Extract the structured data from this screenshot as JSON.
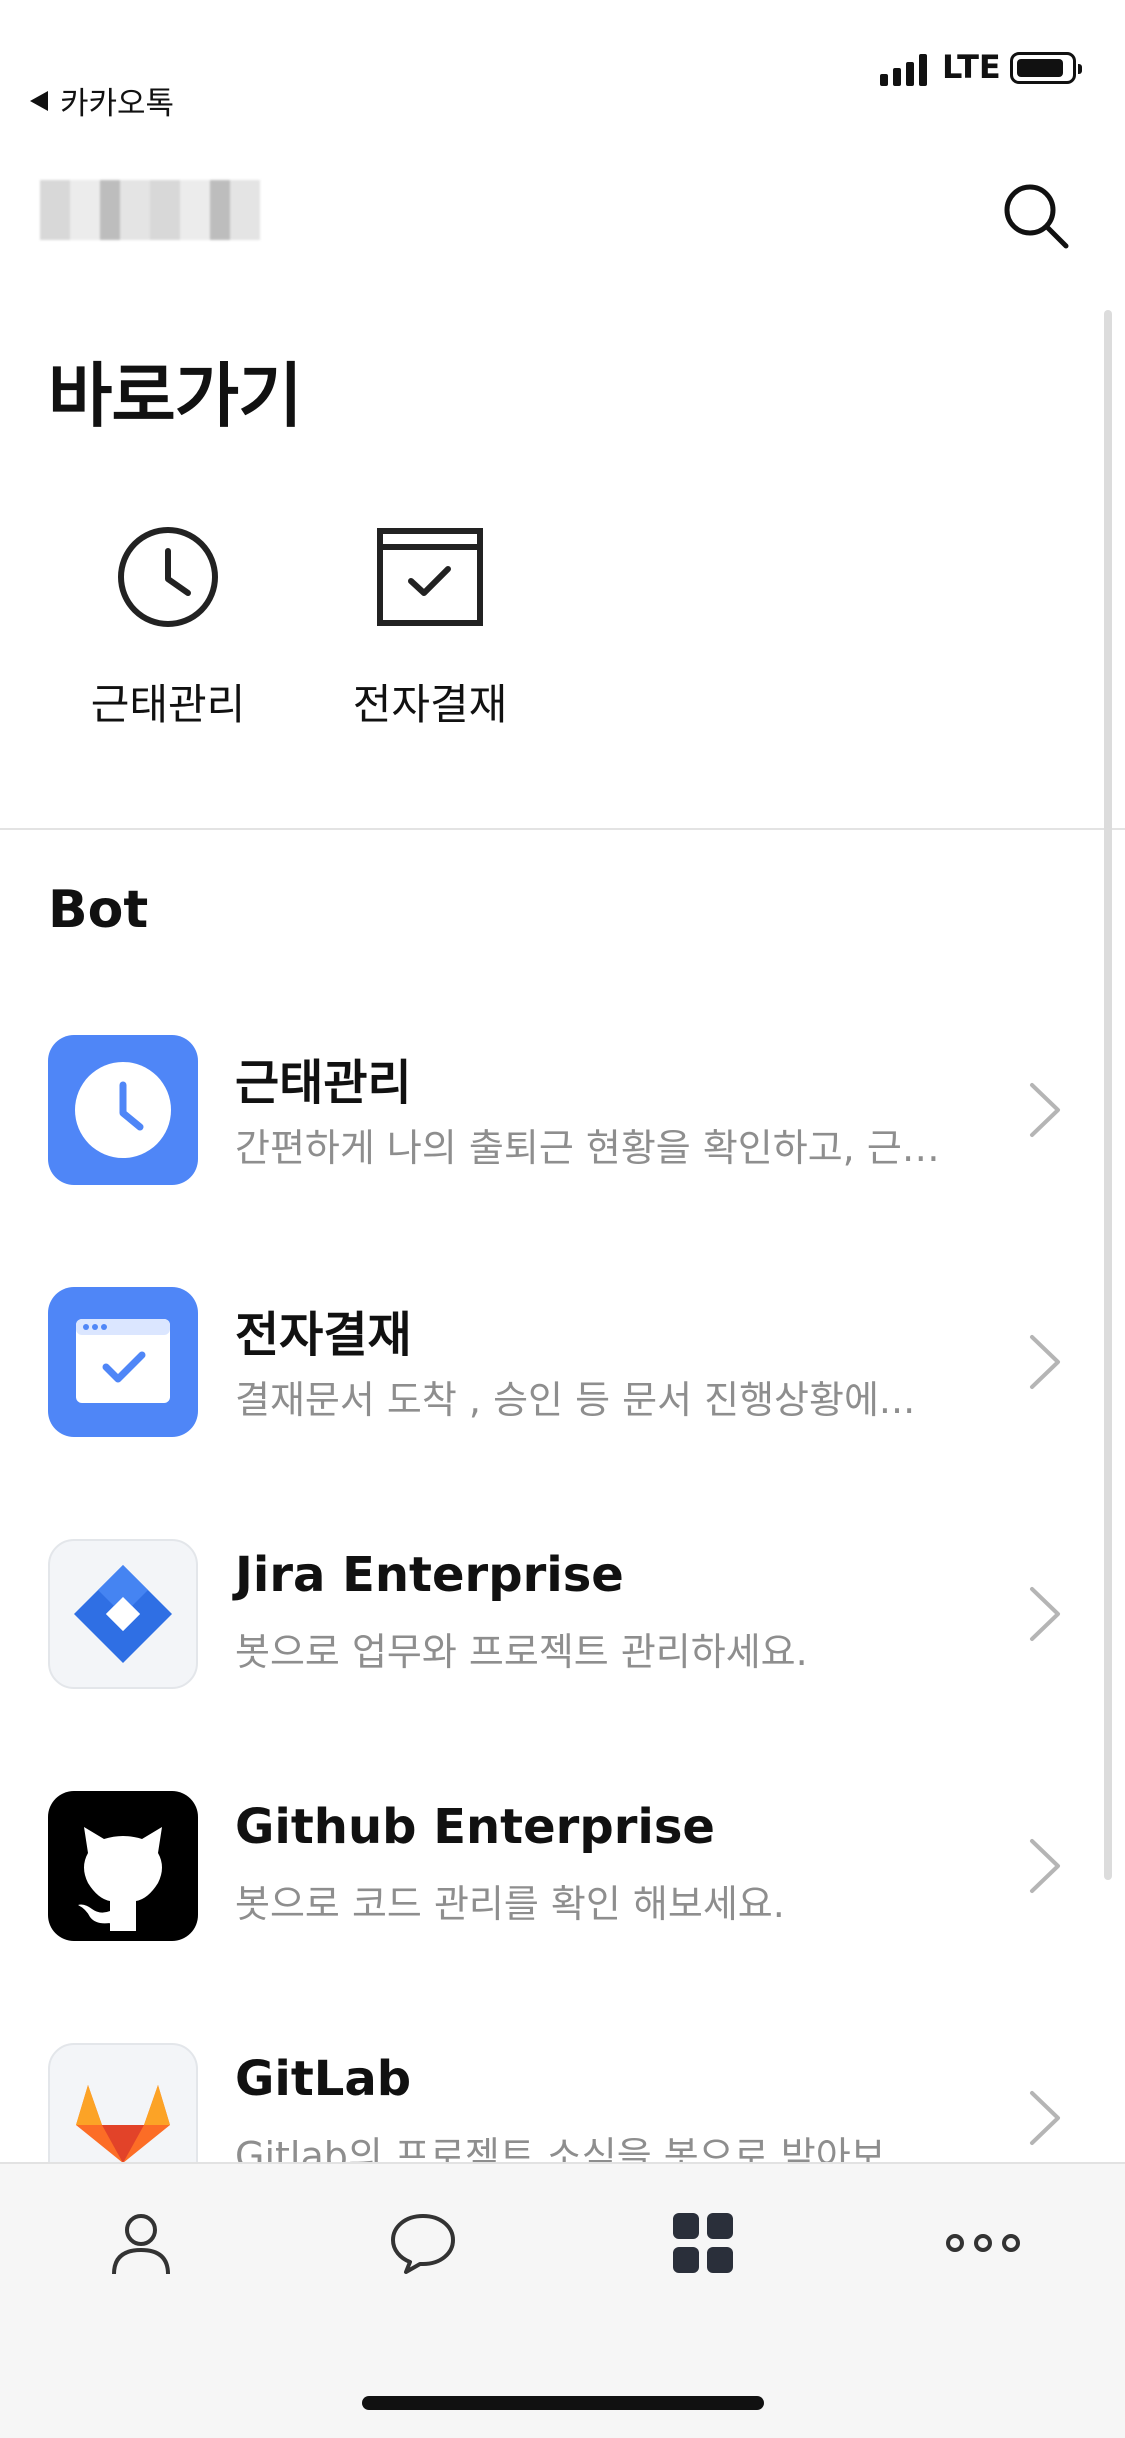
{
  "status_bar": {
    "back_label": "카카오톡",
    "network": "LTE"
  },
  "header": {
    "search_icon": "search-icon"
  },
  "shortcuts": {
    "title": "바로가기",
    "items": [
      {
        "label": "근태관리",
        "icon": "clock-icon"
      },
      {
        "label": "전자결재",
        "icon": "approval-calendar-icon"
      }
    ]
  },
  "bots": {
    "title": "Bot",
    "items": [
      {
        "name": "근태관리",
        "description": "간편하게 나의 출퇴근 현황을 확인하고, 근…",
        "icon": "clock-bot-icon",
        "icon_bg": "#4f86f7"
      },
      {
        "name": "전자결재",
        "description": "결재문서 도착 , 승인 등 문서 진행상황에...",
        "icon": "approval-bot-icon",
        "icon_bg": "#4f86f7"
      },
      {
        "name": "Jira Enterprise",
        "description": "봇으로 업무와 프로젝트 관리하세요.",
        "icon": "jira-icon",
        "icon_bg": "#f3f5f8"
      },
      {
        "name": "Github Enterprise",
        "description": "봇으로 코드 관리를 확인 해보세요.",
        "icon": "github-icon",
        "icon_bg": "#000000"
      },
      {
        "name": "GitLab",
        "description": "Gitlab의 프로젝트 소식을 봇으로 받아보…",
        "icon": "gitlab-icon",
        "icon_bg": "#f3f5f8"
      }
    ]
  },
  "tab_bar": {
    "tabs": [
      {
        "name": "profile",
        "icon": "person-icon"
      },
      {
        "name": "chat",
        "icon": "chat-bubble-icon"
      },
      {
        "name": "apps",
        "icon": "grid-icon",
        "active": true
      },
      {
        "name": "more",
        "icon": "more-dots-icon"
      }
    ]
  },
  "colors": {
    "accent_blue": "#4f86f7",
    "text_secondary": "#8e8e8e",
    "tabbar_bg": "#f6f6f6"
  }
}
